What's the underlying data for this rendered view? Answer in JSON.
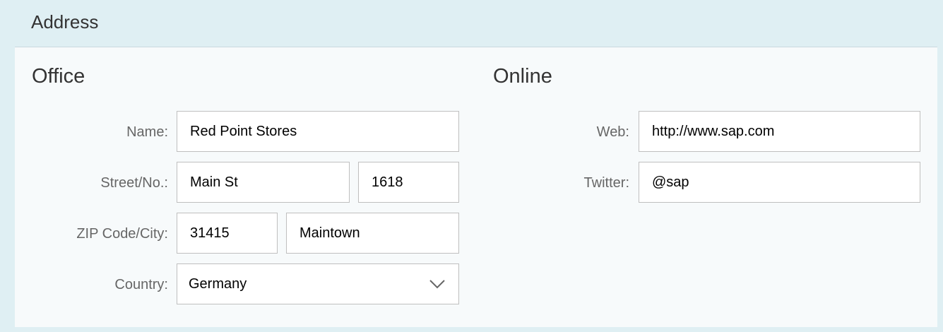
{
  "panel": {
    "title": "Address"
  },
  "office": {
    "title": "Office",
    "name_label": "Name:",
    "name_value": "Red Point Stores",
    "street_label": "Street/No.:",
    "street_value": "Main St",
    "number_value": "1618",
    "zip_label": "ZIP Code/City:",
    "zip_value": "31415",
    "city_value": "Maintown",
    "country_label": "Country:",
    "country_value": "Germany"
  },
  "online": {
    "title": "Online",
    "web_label": "Web:",
    "web_value": "http://www.sap.com",
    "twitter_label": "Twitter:",
    "twitter_value": "@sap"
  },
  "icons": {
    "country_dropdown": "chevron-down-icon"
  }
}
